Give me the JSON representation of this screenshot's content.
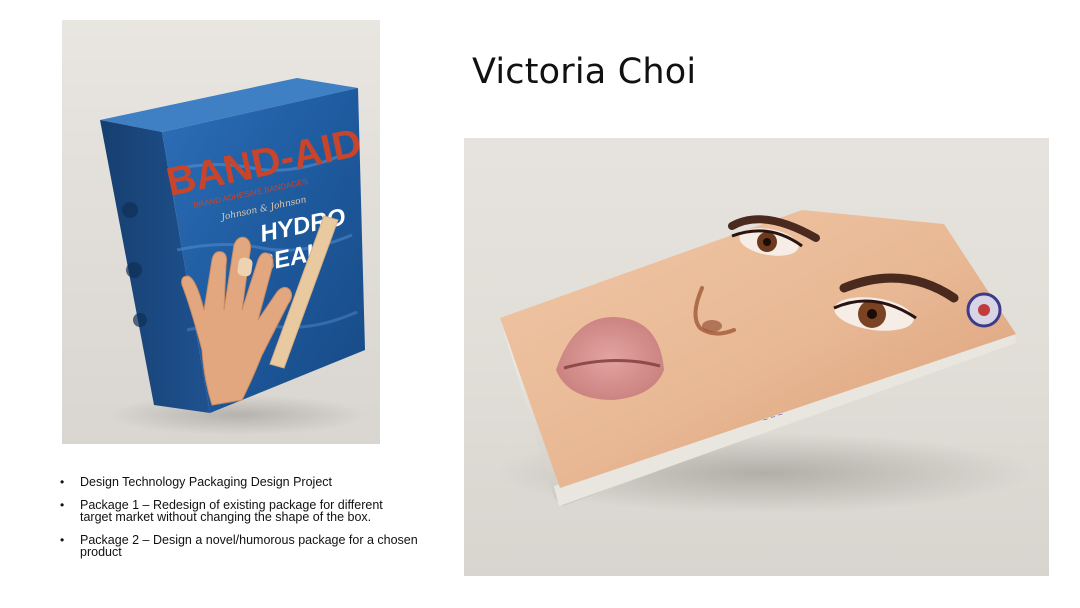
{
  "slide": {
    "title": "Victoria Choi",
    "bullets": [
      "Design Technology Packaging Design Project",
      "Package 1 – Redesign of existing package for different target market without changing the shape of the box.",
      "Package 2 – Design a novel/humorous package for a chosen product"
    ]
  },
  "left_photo": {
    "brand_text": "BAND-AID",
    "subbrand_line1": "HYDRO",
    "subbrand_line2": "SEAL",
    "small_line": "BRAND ADHESIVE BANDAGES",
    "maker": "Johnson & Johnson"
  },
  "colors": {
    "box_blue": "#1f5fa8",
    "brand_red": "#c8442a",
    "text": "#111111"
  }
}
